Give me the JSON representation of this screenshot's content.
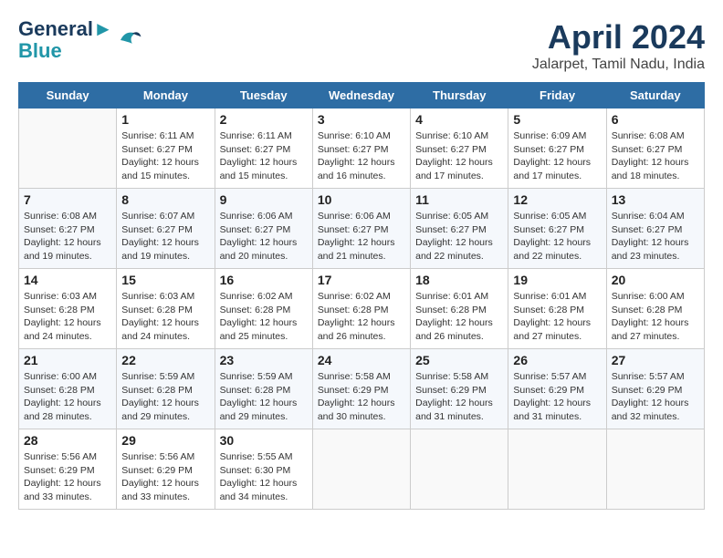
{
  "header": {
    "logo_line1": "General",
    "logo_line2": "Blue",
    "month": "April 2024",
    "location": "Jalarpet, Tamil Nadu, India"
  },
  "days_of_week": [
    "Sunday",
    "Monday",
    "Tuesday",
    "Wednesday",
    "Thursday",
    "Friday",
    "Saturday"
  ],
  "weeks": [
    [
      {
        "num": "",
        "info": ""
      },
      {
        "num": "1",
        "info": "Sunrise: 6:11 AM\nSunset: 6:27 PM\nDaylight: 12 hours\nand 15 minutes."
      },
      {
        "num": "2",
        "info": "Sunrise: 6:11 AM\nSunset: 6:27 PM\nDaylight: 12 hours\nand 15 minutes."
      },
      {
        "num": "3",
        "info": "Sunrise: 6:10 AM\nSunset: 6:27 PM\nDaylight: 12 hours\nand 16 minutes."
      },
      {
        "num": "4",
        "info": "Sunrise: 6:10 AM\nSunset: 6:27 PM\nDaylight: 12 hours\nand 17 minutes."
      },
      {
        "num": "5",
        "info": "Sunrise: 6:09 AM\nSunset: 6:27 PM\nDaylight: 12 hours\nand 17 minutes."
      },
      {
        "num": "6",
        "info": "Sunrise: 6:08 AM\nSunset: 6:27 PM\nDaylight: 12 hours\nand 18 minutes."
      }
    ],
    [
      {
        "num": "7",
        "info": "Sunrise: 6:08 AM\nSunset: 6:27 PM\nDaylight: 12 hours\nand 19 minutes."
      },
      {
        "num": "8",
        "info": "Sunrise: 6:07 AM\nSunset: 6:27 PM\nDaylight: 12 hours\nand 19 minutes."
      },
      {
        "num": "9",
        "info": "Sunrise: 6:06 AM\nSunset: 6:27 PM\nDaylight: 12 hours\nand 20 minutes."
      },
      {
        "num": "10",
        "info": "Sunrise: 6:06 AM\nSunset: 6:27 PM\nDaylight: 12 hours\nand 21 minutes."
      },
      {
        "num": "11",
        "info": "Sunrise: 6:05 AM\nSunset: 6:27 PM\nDaylight: 12 hours\nand 22 minutes."
      },
      {
        "num": "12",
        "info": "Sunrise: 6:05 AM\nSunset: 6:27 PM\nDaylight: 12 hours\nand 22 minutes."
      },
      {
        "num": "13",
        "info": "Sunrise: 6:04 AM\nSunset: 6:27 PM\nDaylight: 12 hours\nand 23 minutes."
      }
    ],
    [
      {
        "num": "14",
        "info": "Sunrise: 6:03 AM\nSunset: 6:28 PM\nDaylight: 12 hours\nand 24 minutes."
      },
      {
        "num": "15",
        "info": "Sunrise: 6:03 AM\nSunset: 6:28 PM\nDaylight: 12 hours\nand 24 minutes."
      },
      {
        "num": "16",
        "info": "Sunrise: 6:02 AM\nSunset: 6:28 PM\nDaylight: 12 hours\nand 25 minutes."
      },
      {
        "num": "17",
        "info": "Sunrise: 6:02 AM\nSunset: 6:28 PM\nDaylight: 12 hours\nand 26 minutes."
      },
      {
        "num": "18",
        "info": "Sunrise: 6:01 AM\nSunset: 6:28 PM\nDaylight: 12 hours\nand 26 minutes."
      },
      {
        "num": "19",
        "info": "Sunrise: 6:01 AM\nSunset: 6:28 PM\nDaylight: 12 hours\nand 27 minutes."
      },
      {
        "num": "20",
        "info": "Sunrise: 6:00 AM\nSunset: 6:28 PM\nDaylight: 12 hours\nand 27 minutes."
      }
    ],
    [
      {
        "num": "21",
        "info": "Sunrise: 6:00 AM\nSunset: 6:28 PM\nDaylight: 12 hours\nand 28 minutes."
      },
      {
        "num": "22",
        "info": "Sunrise: 5:59 AM\nSunset: 6:28 PM\nDaylight: 12 hours\nand 29 minutes."
      },
      {
        "num": "23",
        "info": "Sunrise: 5:59 AM\nSunset: 6:28 PM\nDaylight: 12 hours\nand 29 minutes."
      },
      {
        "num": "24",
        "info": "Sunrise: 5:58 AM\nSunset: 6:29 PM\nDaylight: 12 hours\nand 30 minutes."
      },
      {
        "num": "25",
        "info": "Sunrise: 5:58 AM\nSunset: 6:29 PM\nDaylight: 12 hours\nand 31 minutes."
      },
      {
        "num": "26",
        "info": "Sunrise: 5:57 AM\nSunset: 6:29 PM\nDaylight: 12 hours\nand 31 minutes."
      },
      {
        "num": "27",
        "info": "Sunrise: 5:57 AM\nSunset: 6:29 PM\nDaylight: 12 hours\nand 32 minutes."
      }
    ],
    [
      {
        "num": "28",
        "info": "Sunrise: 5:56 AM\nSunset: 6:29 PM\nDaylight: 12 hours\nand 33 minutes."
      },
      {
        "num": "29",
        "info": "Sunrise: 5:56 AM\nSunset: 6:29 PM\nDaylight: 12 hours\nand 33 minutes."
      },
      {
        "num": "30",
        "info": "Sunrise: 5:55 AM\nSunset: 6:30 PM\nDaylight: 12 hours\nand 34 minutes."
      },
      {
        "num": "",
        "info": ""
      },
      {
        "num": "",
        "info": ""
      },
      {
        "num": "",
        "info": ""
      },
      {
        "num": "",
        "info": ""
      }
    ]
  ]
}
